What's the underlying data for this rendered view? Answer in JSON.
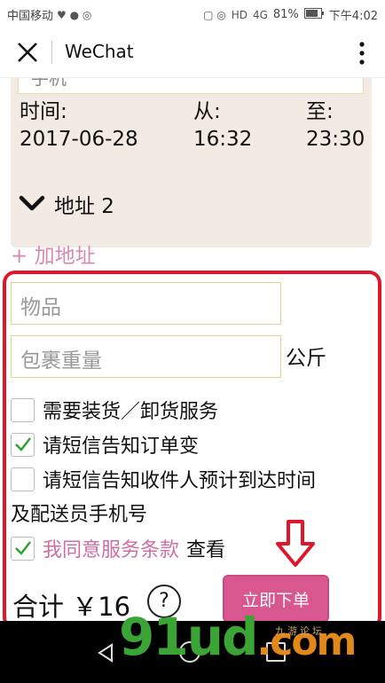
{
  "status_bar": {
    "carrier": "中国移动",
    "battery": "81%",
    "time": "下午4:02",
    "hd_badge": "HD",
    "network": "4G"
  },
  "header": {
    "title": "WeChat"
  },
  "address1": {
    "partial_text": "手机",
    "time_label": "时间:",
    "date": "2017-06-28",
    "from_label": "从:",
    "from_time": "16:32",
    "to_label": "至:",
    "to_time": "23:30"
  },
  "address2": {
    "label": "地址 2"
  },
  "add_address": "+ 加地址",
  "form": {
    "item_placeholder": "物品",
    "weight_placeholder": "包裹重量",
    "weight_unit": "公斤",
    "options": [
      {
        "label": "需要装货／卸货服务",
        "checked": false
      },
      {
        "label": "请短信告知订单变",
        "checked": true
      },
      {
        "label": "请短信告知收件人预计到达时间",
        "checked": false
      }
    ],
    "option3_wrap": "及配送员手机号",
    "terms_label": "我同意服务条款",
    "terms_checked": true,
    "terms_view": "查看"
  },
  "total": {
    "label": "合计 ￥16",
    "help": "?"
  },
  "order_button": "立即下单",
  "watermark": {
    "main": "91ud",
    "suffix": ".com",
    "small": "九游论坛"
  },
  "colors": {
    "accent": "#d9578f",
    "link": "#d58ab0",
    "annotation": "#e0162b",
    "panel": "#f1ebe3",
    "check": "#2aa52a"
  }
}
